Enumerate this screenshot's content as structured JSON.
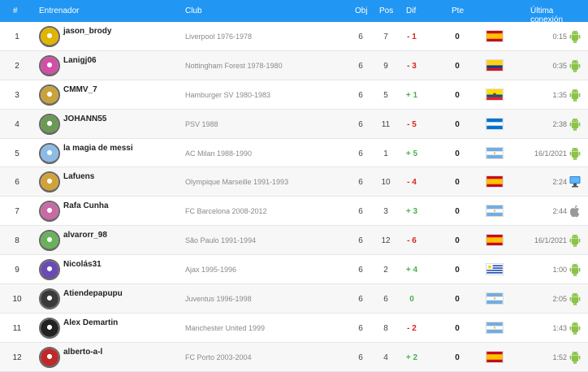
{
  "header": {
    "num": "#",
    "coach": "Entrenador",
    "club": "Club",
    "obj": "Obj",
    "pos": "Pos",
    "dif": "Dif",
    "pte": "Pte",
    "last": "Última conexión"
  },
  "rows": [
    {
      "num": "1",
      "coach": "jason_brody",
      "club": "Liverpool 1976-1978",
      "obj": "6",
      "pos": "7",
      "dif": "- 1",
      "pte": "0",
      "flag": "spain",
      "last": "0:15",
      "device": "android-icon",
      "avatar": "#e0b400"
    },
    {
      "num": "2",
      "coach": "Lanigj06",
      "club": "Nottingham Forest 1978-1980",
      "obj": "6",
      "pos": "9",
      "dif": "- 3",
      "pte": "0",
      "flag": "colombia",
      "last": "0:35",
      "device": "android-icon",
      "avatar": "#d14fa6"
    },
    {
      "num": "3",
      "coach": "CMMV_7",
      "club": "Hamburger SV 1980-1983",
      "obj": "6",
      "pos": "5",
      "dif": "+ 1",
      "pte": "0",
      "flag": "ecuador",
      "last": "1:35",
      "device": "android-icon",
      "avatar": "#c8a23a"
    },
    {
      "num": "4",
      "coach": "JOHANN55",
      "club": "PSV 1988",
      "obj": "6",
      "pos": "11",
      "dif": "- 5",
      "pte": "0",
      "flag": "honduras",
      "last": "2:38",
      "device": "android-icon",
      "avatar": "#6a9a53"
    },
    {
      "num": "5",
      "coach": "la magia de messi",
      "club": "AC Milan 1988-1990",
      "obj": "6",
      "pos": "1",
      "dif": "+ 5",
      "pte": "0",
      "flag": "argentina",
      "last": "16/1/2021",
      "device": "android-icon",
      "avatar": "#8bbbe6"
    },
    {
      "num": "6",
      "coach": "Lafuens",
      "club": "Olympique Marseille 1991-1993",
      "obj": "6",
      "pos": "10",
      "dif": "- 4",
      "pte": "0",
      "flag": "spain",
      "last": "2:24",
      "device": "desktop-icon",
      "avatar": "#d2a23a"
    },
    {
      "num": "7",
      "coach": "Rafa Cunha",
      "club": "FC Barcelona 2008-2012",
      "obj": "6",
      "pos": "3",
      "dif": "+ 3",
      "pte": "0",
      "flag": "argentina",
      "last": "2:44",
      "device": "apple-icon",
      "avatar": "#c96aa5"
    },
    {
      "num": "8",
      "coach": "alvarorr_98",
      "club": "São Paulo 1991-1994",
      "obj": "6",
      "pos": "12",
      "dif": "- 6",
      "pte": "0",
      "flag": "spain",
      "last": "16/1/2021",
      "device": "android-icon",
      "avatar": "#6ab15b"
    },
    {
      "num": "9",
      "coach": "Nicolás31",
      "club": "Ajax 1995-1996",
      "obj": "6",
      "pos": "2",
      "dif": "+ 4",
      "pte": "0",
      "flag": "uruguay",
      "last": "1:00",
      "device": "android-icon",
      "avatar": "#6a4bb3"
    },
    {
      "num": "10",
      "coach": "Atiendepapupu",
      "club": "Juventus 1996-1998",
      "obj": "6",
      "pos": "6",
      "dif": "0",
      "pte": "0",
      "flag": "argentina",
      "last": "2:05",
      "device": "android-icon",
      "avatar": "#3a3a3a"
    },
    {
      "num": "11",
      "coach": "Alex Demartin",
      "club": "Manchester United 1999",
      "obj": "6",
      "pos": "8",
      "dif": "- 2",
      "pte": "0",
      "flag": "argentina",
      "last": "1:43",
      "device": "android-icon",
      "avatar": "#222222"
    },
    {
      "num": "12",
      "coach": "alberto-a-l",
      "club": "FC Porto 2003-2004",
      "obj": "6",
      "pos": "4",
      "dif": "+ 2",
      "pte": "0",
      "flag": "spain",
      "last": "1:52",
      "device": "android-icon",
      "avatar": "#c0282a"
    }
  ],
  "colors": {
    "header_bg": "#2196f3",
    "negative": "#d9261c",
    "positive": "#4caf50",
    "android": "#8bc34a"
  }
}
